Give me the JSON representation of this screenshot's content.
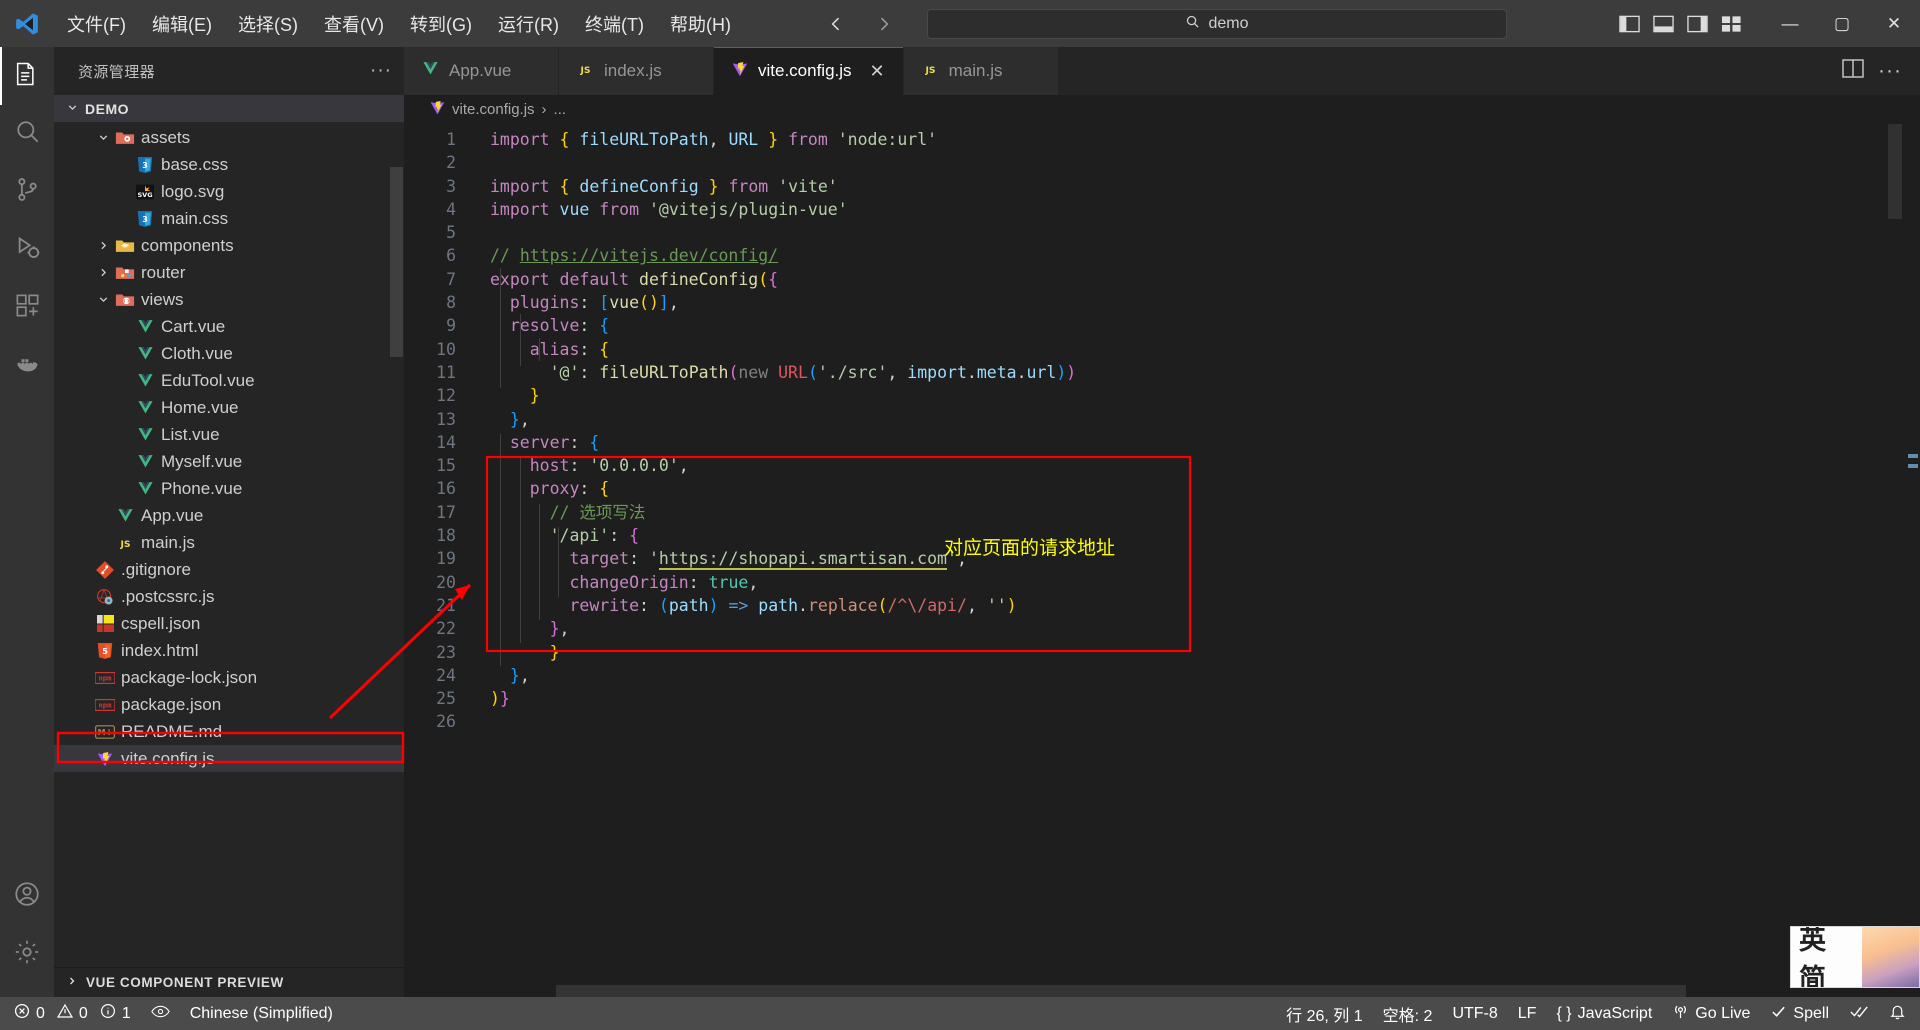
{
  "titlebar": {
    "menus": [
      "文件(F)",
      "编辑(E)",
      "选择(S)",
      "查看(V)",
      "转到(G)",
      "运行(R)",
      "终端(T)",
      "帮助(H)"
    ],
    "search_value": "demo",
    "search_icon": "search-icon",
    "back_icon": "arrow-left-icon",
    "forward_icon": "arrow-right-icon",
    "minimize": "—",
    "maximize": "▢",
    "close": "✕"
  },
  "activitybar": {
    "items": [
      {
        "name": "explorer",
        "icon": "files-icon"
      },
      {
        "name": "search",
        "icon": "search-icon"
      },
      {
        "name": "source-control",
        "icon": "source-control-icon"
      },
      {
        "name": "run-debug",
        "icon": "run-debug-icon"
      },
      {
        "name": "extensions",
        "icon": "extensions-icon"
      },
      {
        "name": "docker",
        "icon": "docker-icon"
      },
      {
        "name": "account",
        "icon": "account-icon"
      },
      {
        "name": "settings",
        "icon": "gear-icon"
      }
    ]
  },
  "sidebar": {
    "title": "资源管理器",
    "more": "···",
    "folder": "DEMO",
    "tree": [
      {
        "label": "assets",
        "indent": 1,
        "type": "folder",
        "expanded": true,
        "icon": "folder-assets-icon"
      },
      {
        "label": "base.css",
        "indent": 2,
        "type": "file",
        "icon": "css-icon"
      },
      {
        "label": "logo.svg",
        "indent": 2,
        "type": "file",
        "icon": "svg-icon"
      },
      {
        "label": "main.css",
        "indent": 2,
        "type": "file",
        "icon": "css-icon"
      },
      {
        "label": "components",
        "indent": 1,
        "type": "folder",
        "expanded": false,
        "icon": "folder-components-icon"
      },
      {
        "label": "router",
        "indent": 1,
        "type": "folder",
        "expanded": false,
        "icon": "folder-router-icon"
      },
      {
        "label": "views",
        "indent": 1,
        "type": "folder",
        "expanded": true,
        "icon": "folder-views-icon"
      },
      {
        "label": "Cart.vue",
        "indent": 2,
        "type": "file",
        "icon": "vue-icon"
      },
      {
        "label": "Cloth.vue",
        "indent": 2,
        "type": "file",
        "icon": "vue-icon"
      },
      {
        "label": "EduTool.vue",
        "indent": 2,
        "type": "file",
        "icon": "vue-icon"
      },
      {
        "label": "Home.vue",
        "indent": 2,
        "type": "file",
        "icon": "vue-icon"
      },
      {
        "label": "List.vue",
        "indent": 2,
        "type": "file",
        "icon": "vue-icon"
      },
      {
        "label": "Myself.vue",
        "indent": 2,
        "type": "file",
        "icon": "vue-icon"
      },
      {
        "label": "Phone.vue",
        "indent": 2,
        "type": "file",
        "icon": "vue-icon"
      },
      {
        "label": "App.vue",
        "indent": 1,
        "type": "file",
        "icon": "vue-icon"
      },
      {
        "label": "main.js",
        "indent": 1,
        "type": "file",
        "icon": "js-icon"
      },
      {
        "label": ".gitignore",
        "indent": 0,
        "type": "file",
        "icon": "git-icon"
      },
      {
        "label": ".postcssrc.js",
        "indent": 0,
        "type": "file",
        "icon": "postcss-icon"
      },
      {
        "label": "cspell.json",
        "indent": 0,
        "type": "file",
        "icon": "cspell-icon"
      },
      {
        "label": "index.html",
        "indent": 0,
        "type": "file",
        "icon": "html5-icon"
      },
      {
        "label": "package-lock.json",
        "indent": 0,
        "type": "file",
        "icon": "npm-icon"
      },
      {
        "label": "package.json",
        "indent": 0,
        "type": "file",
        "icon": "npm-icon"
      },
      {
        "label": "README.md",
        "indent": 0,
        "type": "file",
        "icon": "markdown-icon"
      },
      {
        "label": "vite.config.js",
        "indent": 0,
        "type": "file",
        "icon": "vite-icon",
        "selected": true,
        "highlighted": true
      }
    ],
    "section": "VUE COMPONENT PREVIEW"
  },
  "editor": {
    "tabs": [
      {
        "label": "App.vue",
        "icon": "vue-icon",
        "active": false,
        "closable": false
      },
      {
        "label": "index.js",
        "icon": "js-icon",
        "active": false,
        "closable": false
      },
      {
        "label": "vite.config.js",
        "icon": "vite-icon",
        "active": true,
        "closable": true
      },
      {
        "label": "main.js",
        "icon": "js-icon",
        "active": false,
        "closable": false
      }
    ],
    "tab_close": "✕",
    "split_icon": "split-editor-icon",
    "more_icon": "more-actions-icon",
    "breadcrumb": {
      "file": "vite.config.js",
      "separator": "›",
      "rest": "..."
    },
    "line_numbers": [
      1,
      2,
      3,
      4,
      5,
      6,
      7,
      8,
      9,
      10,
      11,
      12,
      13,
      14,
      15,
      16,
      17,
      18,
      19,
      20,
      21,
      22,
      23,
      24,
      25,
      26
    ],
    "code_lines": [
      "import { fileURLToPath, URL } from 'node:url'",
      "",
      "import { defineConfig } from 'vite'",
      "import vue from '@vitejs/plugin-vue'",
      "",
      "// https://vitejs.dev/config/",
      "export default defineConfig({",
      "  plugins: [vue()],",
      "  resolve: {",
      "    alias: {",
      "      '@': fileURLToPath(new URL('./src', import.meta.url))",
      "    }",
      "  },",
      "  server: {",
      "    host: '0.0.0.0',",
      "    proxy: {",
      "      // 选项写法",
      "      '/api': {",
      "        target: 'https://shopapi.smartisan.com',",
      "        changeOrigin: true,",
      "        rewrite: (path) => path.replace(/^\\/api/, '')",
      "      },",
      "      }",
      "  },",
      "})",
      ""
    ],
    "annotation_text": "对应页面的请求地址"
  },
  "statusbar": {
    "errors": "0",
    "warnings": "0",
    "infos": "1",
    "eye_icon": "eye-icon",
    "language_locale": "Chinese (Simplified)",
    "cursor_position": "行 26, 列 1",
    "indentation": "空格: 2",
    "encoding": "UTF-8",
    "eol": "LF",
    "language_mode": "JavaScript",
    "go_live": "Go Live",
    "spell": "Spell",
    "check_icon": "check-icon",
    "broadcast_icon": "broadcast-icon",
    "bell_icon": "bell-icon"
  },
  "ime": {
    "text": "英 简"
  }
}
